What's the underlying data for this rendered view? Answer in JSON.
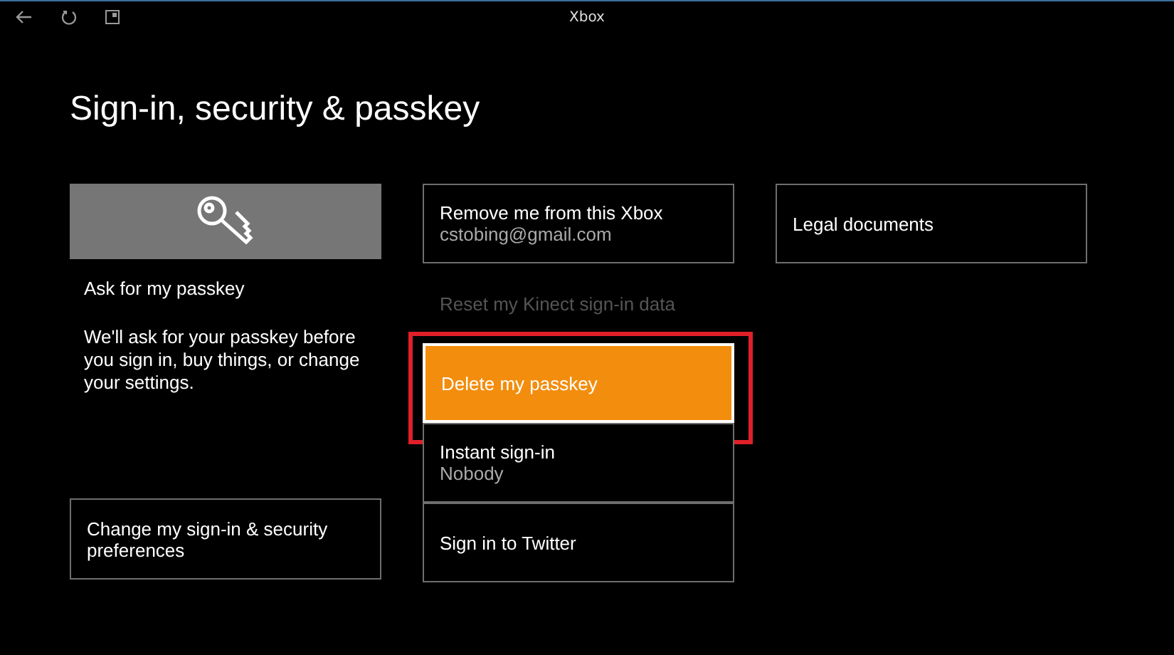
{
  "window": {
    "title": "Xbox"
  },
  "page_title": "Sign-in, security & passkey",
  "passkey_tile": {
    "label": "Ask for my passkey",
    "description": "We'll ask for your passkey before you sign in, buy things, or change your settings."
  },
  "preferences_tile": {
    "label": "Change my sign-in & security preferences"
  },
  "options": [
    {
      "label": "Remove me from this Xbox",
      "detail": "cstobing@gmail.com",
      "selected": false,
      "disabled": false,
      "highlighted": false
    },
    {
      "label": "Reset my Kinect sign-in data",
      "selected": false,
      "disabled": true,
      "highlighted": false
    },
    {
      "label": "Delete my passkey",
      "selected": true,
      "disabled": false,
      "highlighted": true
    },
    {
      "label": "Instant sign-in",
      "detail": "Nobody",
      "selected": false,
      "disabled": false,
      "highlighted": false
    },
    {
      "label": "Sign in to Twitter",
      "selected": false,
      "disabled": false,
      "highlighted": false
    }
  ],
  "legal_tile": {
    "label": "Legal documents"
  }
}
